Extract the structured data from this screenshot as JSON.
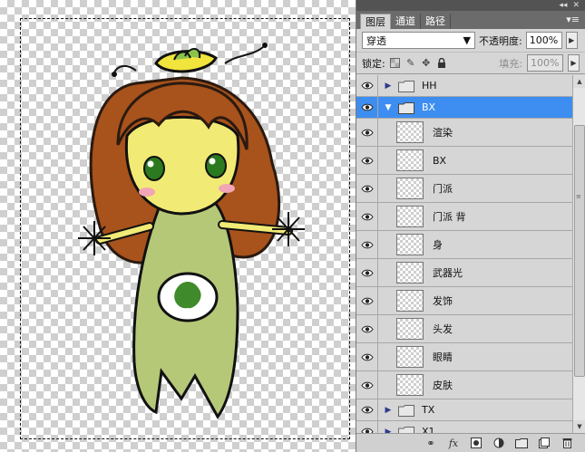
{
  "panel": {
    "tabs": [
      {
        "label": "图层",
        "active": true
      },
      {
        "label": "通道",
        "active": false
      },
      {
        "label": "路径",
        "active": false
      }
    ],
    "menu_icon": "panel-menu-icon",
    "blend_mode": "穿透",
    "opacity_label": "不透明度:",
    "opacity_value": "100%",
    "lock_label": "锁定:",
    "fill_label": "填充:",
    "fill_value": "100%"
  },
  "layers": [
    {
      "name": "HH",
      "type": "group",
      "expanded": false
    },
    {
      "name": "BX",
      "type": "group",
      "expanded": true,
      "selected": true
    },
    {
      "name": "渲染",
      "type": "layer"
    },
    {
      "name": "BX",
      "type": "layer"
    },
    {
      "name": "门派",
      "type": "layer"
    },
    {
      "name": "门派 背",
      "type": "layer"
    },
    {
      "name": "身",
      "type": "layer"
    },
    {
      "name": "武器光",
      "type": "layer"
    },
    {
      "name": "发饰",
      "type": "layer"
    },
    {
      "name": "头发",
      "type": "layer"
    },
    {
      "name": "眼睛",
      "type": "layer"
    },
    {
      "name": "皮肤",
      "type": "layer"
    },
    {
      "name": "TX",
      "type": "group",
      "expanded": false
    },
    {
      "name": "X1",
      "type": "group",
      "expanded": false
    }
  ],
  "toolbar": [
    "link-layers-icon",
    "layer-style-fx-icon",
    "add-mask-icon",
    "adjustment-layer-icon",
    "new-group-icon",
    "new-layer-icon",
    "delete-layer-icon"
  ]
}
